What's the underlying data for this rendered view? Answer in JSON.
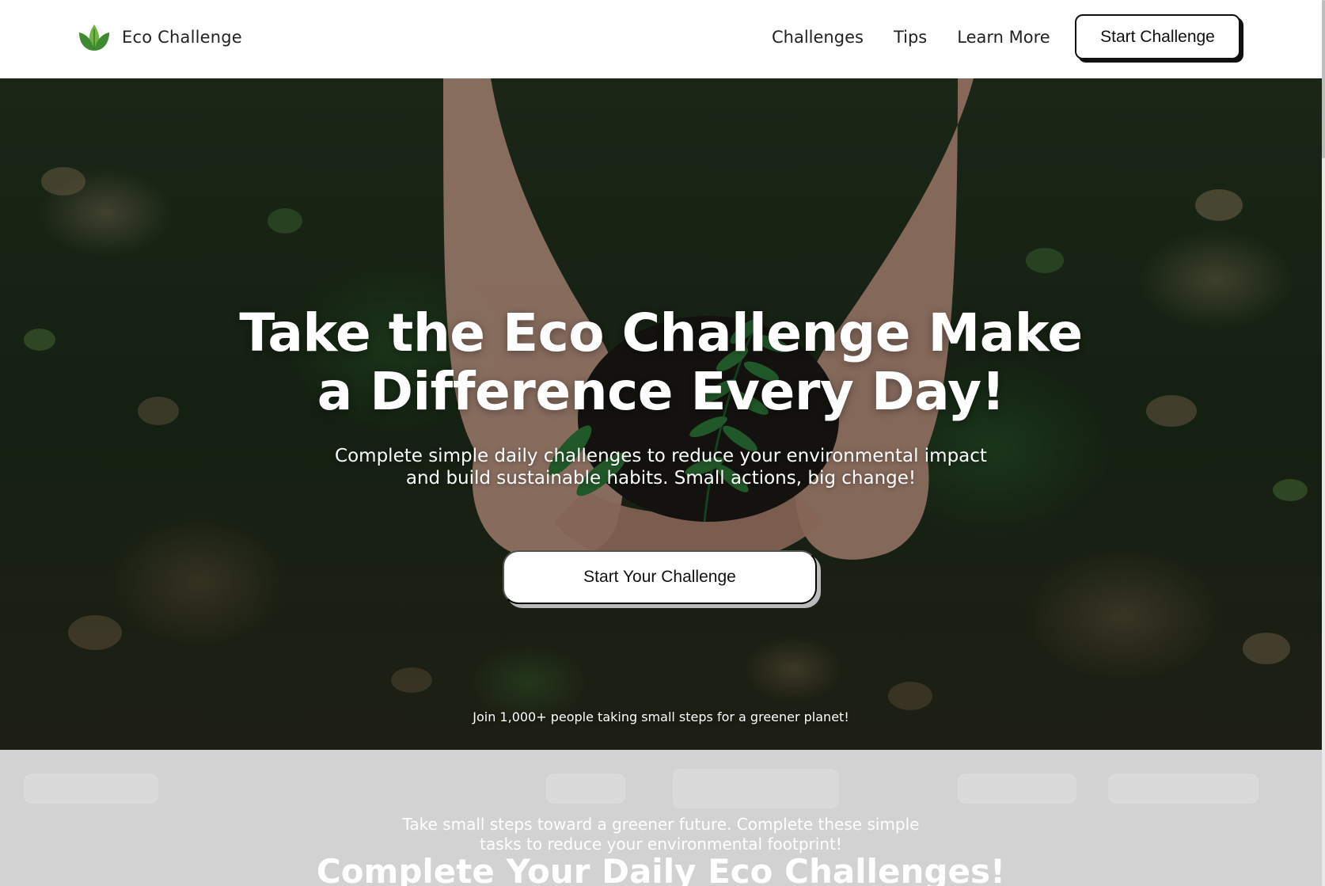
{
  "nav": {
    "brand_name": "Eco Challenge",
    "links": [
      "Challenges",
      "Tips",
      "Learn More"
    ],
    "cta_label": "Start Challenge"
  },
  "hero": {
    "title_line1": "Take the Eco Challenge Make",
    "title_line2": "a Difference Every Day!",
    "subtitle_line1": "Complete simple daily challenges to reduce your environmental impact",
    "subtitle_line2": "and build sustainable habits. Small actions, big change!",
    "cta_label": "Start Your Challenge",
    "note": "Join 1,000+ people taking small steps for a greener planet!"
  },
  "challenges_section": {
    "description_line1": "Take small steps toward a greener future. Complete these simple",
    "description_line2": "tasks to reduce your environmental footprint!",
    "title": "Complete Your Daily Eco Challenges!"
  },
  "colors": {
    "logo_green": "#4f9a3a",
    "hero_foliage": "#1f3a1c",
    "section_bg": "#d2d2d2",
    "nav_bg": "#ffffff"
  },
  "icons": {
    "brand": "leaf-logo-icon"
  }
}
